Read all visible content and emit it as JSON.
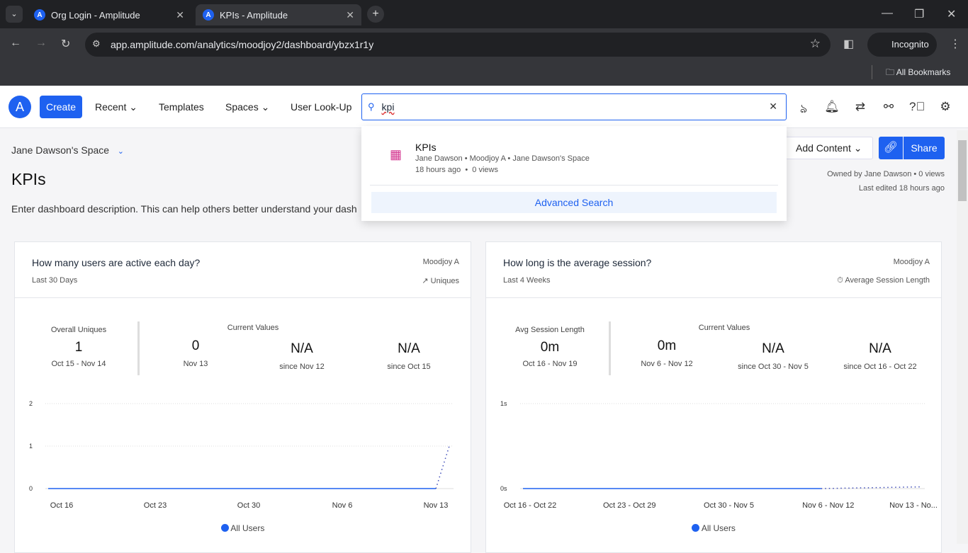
{
  "browser": {
    "tabs": [
      {
        "title": "Org Login - Amplitude",
        "active": false
      },
      {
        "title": "KPIs - Amplitude",
        "active": true
      }
    ],
    "url": "app.amplitude.com/analytics/moodjoy2/dashboard/ybzx1r1y",
    "profile": "Incognito",
    "bookmarks_label": "All Bookmarks"
  },
  "nav": {
    "create": "Create",
    "recent": "Recent",
    "templates": "Templates",
    "spaces": "Spaces",
    "lookup": "User Look-Up",
    "search_value": "kpi",
    "accent": "#1e61f0"
  },
  "search_results": {
    "items": [
      {
        "title": "KPIs",
        "meta": "Jane Dawson • Moodjoy A • Jane Dawson's Space",
        "time": "18 hours ago",
        "views": "0 views",
        "icon": "dashboard-icon"
      }
    ],
    "advanced": "Advanced Search"
  },
  "page": {
    "space": "Jane Dawson's Space",
    "title": "KPIs",
    "description": "Enter dashboard description. This can help others better understand your dash",
    "add_content": "Add Content",
    "share": "Share",
    "owned": "Owned by Jane Dawson • 0 views",
    "edited": "Last edited 18 hours ago"
  },
  "cards": [
    {
      "title": "How many users are active each day?",
      "project": "Moodjoy A",
      "range": "Last 30 Days",
      "metric_type": "Uniques",
      "overall": {
        "label": "Overall Uniques",
        "value": "1",
        "range": "Oct 15 - Nov 14"
      },
      "current_label": "Current Values",
      "current": [
        {
          "value": "0",
          "sub": "Nov 13"
        },
        {
          "value": "N/A",
          "sub": "since Nov 12"
        },
        {
          "value": "N/A",
          "sub": "since Oct 15"
        }
      ],
      "legend": "All Users"
    },
    {
      "title": "How long is the average session?",
      "project": "Moodjoy A",
      "range": "Last 4 Weeks",
      "metric_type": "Average Session Length",
      "overall": {
        "label": "Avg Session Length",
        "value": "0m",
        "range": "Oct 16 - Nov 19"
      },
      "current_label": "Current Values",
      "current": [
        {
          "value": "0m",
          "sub": "Nov 6 - Nov 12"
        },
        {
          "value": "N/A",
          "sub": "since Oct 30 - Nov 5"
        },
        {
          "value": "N/A",
          "sub": "since Oct 16 - Oct 22"
        }
      ],
      "legend": "All Users"
    }
  ],
  "chart_data": [
    {
      "type": "line",
      "yticks": [
        "0",
        "1",
        "2"
      ],
      "ylim": [
        0,
        2
      ],
      "xticks": [
        "Oct 16",
        "Oct 23",
        "Oct 30",
        "Nov 6",
        "Nov 13"
      ],
      "series": [
        {
          "name": "All Users",
          "color": "#1e61f0",
          "x_days": "Oct 15 - Nov 14",
          "values": [
            0,
            0,
            0,
            0,
            0,
            0,
            0,
            0,
            0,
            0,
            0,
            0,
            0,
            0,
            0,
            0,
            0,
            0,
            0,
            0,
            0,
            0,
            0,
            0,
            0,
            0,
            0,
            0,
            0,
            0,
            1
          ],
          "incomplete_from_index": 29
        }
      ]
    },
    {
      "type": "line",
      "yticks": [
        "0s",
        "1s"
      ],
      "ylim": [
        0,
        1
      ],
      "xticks": [
        "Oct 16 - Oct 22",
        "Oct 23 - Oct 29",
        "Oct 30 - Nov 5",
        "Nov 6 - Nov 12",
        "Nov 13 - No..."
      ],
      "series": [
        {
          "name": "All Users",
          "color": "#1e61f0",
          "values": [
            0,
            0,
            0,
            0,
            0.02
          ],
          "incomplete_from_index": 3
        }
      ]
    }
  ]
}
